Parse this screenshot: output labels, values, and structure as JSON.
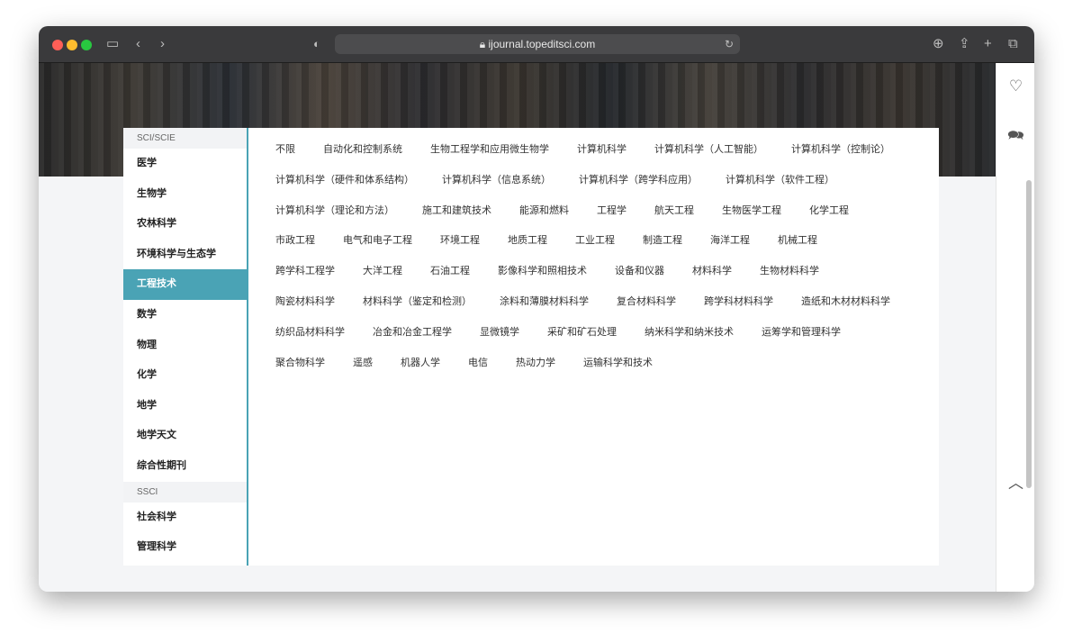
{
  "browser": {
    "url": "ijournal.topeditsci.com"
  },
  "sidebar": {
    "sections": [
      {
        "title": "SCI/SCIE",
        "items": [
          "医学",
          "生物学",
          "农林科学",
          "环境科学与生态学",
          "工程技术",
          "数学",
          "物理",
          "化学",
          "地学",
          "地学天文",
          "综合性期刊"
        ]
      },
      {
        "title": "SSCI",
        "items": [
          "社会科学",
          "管理科学"
        ]
      }
    ],
    "active": "工程技术"
  },
  "tags": [
    "不限",
    "自动化和控制系统",
    "生物工程学和应用微生物学",
    "计算机科学",
    "计算机科学（人工智能）",
    "计算机科学（控制论）",
    "计算机科学（硬件和体系结构）",
    "计算机科学（信息系统）",
    "计算机科学（跨学科应用）",
    "计算机科学（软件工程）",
    "计算机科学（理论和方法）",
    "施工和建筑技术",
    "能源和燃料",
    "工程学",
    "航天工程",
    "生物医学工程",
    "化学工程",
    "市政工程",
    "电气和电子工程",
    "环境工程",
    "地质工程",
    "工业工程",
    "制造工程",
    "海洋工程",
    "机械工程",
    "跨学科工程学",
    "大洋工程",
    "石油工程",
    "影像科学和照相技术",
    "设备和仪器",
    "材料科学",
    "生物材料科学",
    "陶瓷材料科学",
    "材料科学（鉴定和检测）",
    "涂料和薄膜材料科学",
    "复合材料科学",
    "跨学科材料科学",
    "造纸和木材材料科学",
    "纺织品材料科学",
    "冶金和冶金工程学",
    "显微镜学",
    "采矿和矿石处理",
    "纳米科学和纳米技术",
    "运筹学和管理科学",
    "聚合物科学",
    "遥感",
    "机器人学",
    "电信",
    "热动力学",
    "运输科学和技术"
  ],
  "colors": {
    "accent": "#4aa3b5"
  }
}
